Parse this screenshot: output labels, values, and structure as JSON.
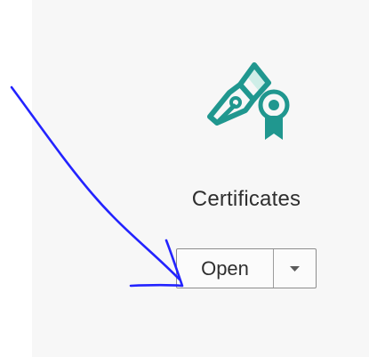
{
  "tool": {
    "label": "Certificates",
    "icon": "pen-certificate-icon",
    "open_label": "Open",
    "dropdown_icon": "chevron-down-icon"
  },
  "colors": {
    "tile_background": "#f7f7f7",
    "icon_teal": "#20978f",
    "icon_mint": "#cfeee8",
    "annotation_blue": "#2323ff"
  }
}
